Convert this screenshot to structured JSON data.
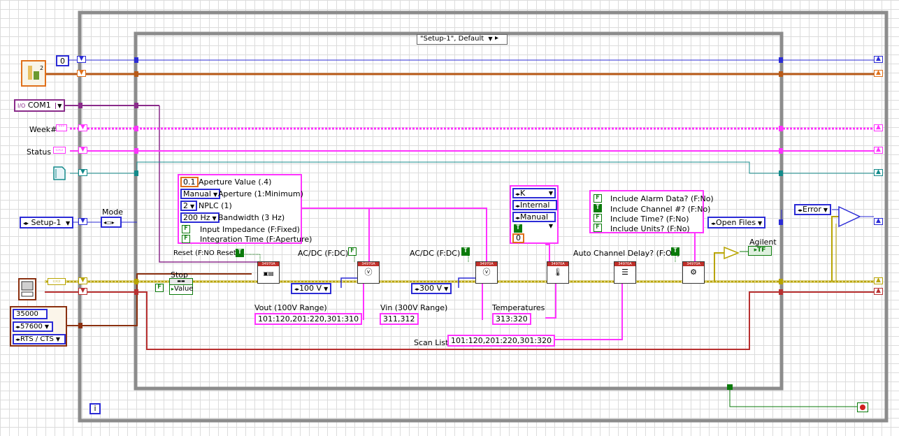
{
  "case_selector": {
    "label": "\"Setup-1\", Default"
  },
  "left_inputs": {
    "index_value": "0",
    "com_port": "COM1",
    "week_label": "Week#",
    "status_label": "Status",
    "mode_label": "Mode",
    "setup_value": "Setup-1",
    "serial_settings": [
      "35000",
      "57600",
      "RTS / CTS"
    ]
  },
  "config_panel": {
    "aperture_value": "0.1",
    "aperture_value_label": "Aperture Value (.4)",
    "aperture_mode": "Manual",
    "aperture_mode_label": "Aperture (1:Minimum)",
    "nplc": "2",
    "nplc_label": "NPLC (1)",
    "bandwidth": "200 Hz",
    "bandwidth_label": "Bandwidth (3 Hz)",
    "input_impedance_label": "Input Impedance (F:Fixed)",
    "integration_time_label": "Integration Time (F:Aperture)"
  },
  "bool_letters": {
    "false": "F",
    "true": "T"
  },
  "reset_label": "Reset (F:NO Reset)",
  "stop_label": "Stop",
  "stop_value": "Value",
  "acdc_label_1": "AC/DC (F:DC)",
  "acdc_label_2": "AC/DC (F:DC)",
  "range_100": "100 V",
  "range_300": "300 V",
  "vout_label": "Vout (100V Range)",
  "vout_value": "101:120,201:220,301:310",
  "vin_label": "Vin (300V Range)",
  "vin_value": "311,312",
  "temp_panel": {
    "unit": "K",
    "source": "Internal",
    "mode": "Manual",
    "value": "0"
  },
  "temps_label": "Temperatures",
  "temps_value": "313:320",
  "scan_list_label": "Scan List",
  "scan_list_value": "101:120,201:220,301:320",
  "auto_delay_label": "Auto Channel Delay? (F:Off)",
  "format_panel": {
    "alarm_label": "Include Alarm Data? (F:No)",
    "channel_label": "Include Channel #? (F:No)",
    "time_label": "Include Time? (F:No)",
    "units_label": "Include Units? (F:No)"
  },
  "open_files": "Open Files",
  "error_value": "Error",
  "agilent_label": "Agilent",
  "agilent_tf": "TF",
  "info_button": "i",
  "colors": {
    "blue": "#2b2bd6",
    "pink": "#ff33ff",
    "orange": "#e0701a",
    "teal": "#138a8a",
    "frame": "#888888"
  }
}
